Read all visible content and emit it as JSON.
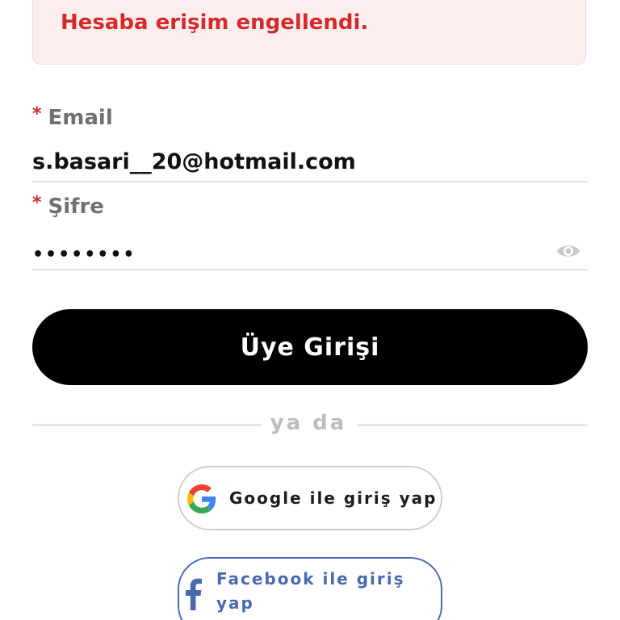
{
  "alert": {
    "message": "Hesaba erişim engellendi."
  },
  "form": {
    "required_mark": "*",
    "email_label": "Email",
    "email_value": "s.basari__20@hotmail.com",
    "password_label": "Şifre",
    "password_value": "••••••••",
    "submit_label": "Üye Girişi"
  },
  "divider": {
    "text": "ya da"
  },
  "social": {
    "google_label": "Google ile giriş yap",
    "facebook_label": "Facebook ile giriş yap"
  },
  "icons": {
    "password_toggle": "eye-icon",
    "google": "google-logo-icon",
    "facebook": "facebook-logo-icon"
  },
  "colors": {
    "error": "#d42a2a",
    "alert_bg": "#fdeeee",
    "primary_button": "#000000",
    "facebook": "#4a6ab0"
  }
}
